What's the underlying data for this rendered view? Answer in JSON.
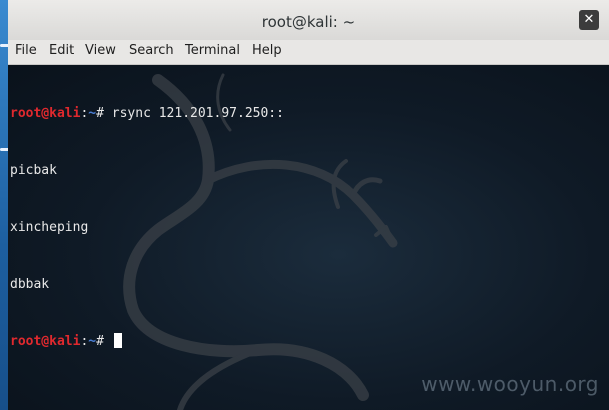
{
  "window": {
    "title": "root@kali: ~",
    "close_glyph": "✕"
  },
  "menu": {
    "items": [
      {
        "label": "File"
      },
      {
        "label": "Edit"
      },
      {
        "label": "View"
      },
      {
        "label": "Search"
      },
      {
        "label": "Terminal"
      },
      {
        "label": "Help"
      }
    ]
  },
  "terminal": {
    "prompt_user": "root@kali",
    "prompt_sep": ":",
    "prompt_path": "~",
    "prompt_symbol": "#",
    "command": " rsync 121.201.97.250::",
    "output": [
      "picbak",
      "xincheping",
      "dbbak"
    ]
  },
  "watermark": "www.wooyun.org",
  "colors": {
    "prompt_user": "#e0292e",
    "prompt_path": "#4a7fd6",
    "terminal_bg": "#0f1a26",
    "text": "#e8e8e8"
  },
  "icons": {
    "close": "close-icon",
    "background": "kali-dragon-logo"
  }
}
